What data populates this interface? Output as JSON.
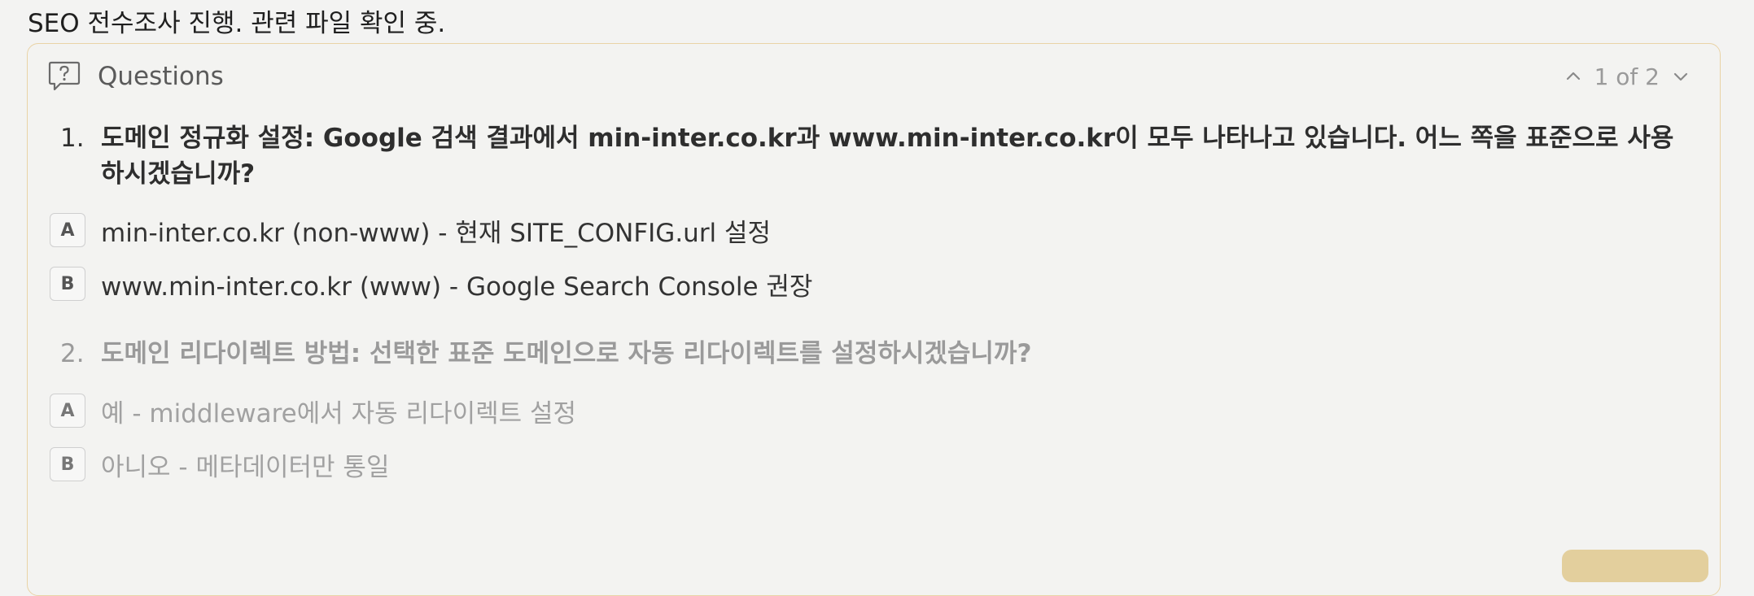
{
  "intro": "SEO 전수조사 진행. 관련 파일 확인 중.",
  "panel": {
    "title": "Questions",
    "pager": "1 of 2",
    "icons": {
      "header": "question-bubble-icon",
      "prev": "chevron-up-icon",
      "next": "chevron-down-icon"
    },
    "accent_border": "#e9d3a6",
    "submit_color": "#e3cf9d"
  },
  "questions": [
    {
      "number": "1.",
      "text": "도메인 정규화 설정: Google 검색 결과에서 min-inter.co.kr과 www.min-inter.co.kr이 모두 나타나고 있습니다. 어느 쪽을 표준으로 사용하시겠습니까?",
      "options": [
        {
          "key": "A",
          "label": "min-inter.co.kr (non-www) - 현재 SITE_CONFIG.url 설정"
        },
        {
          "key": "B",
          "label": "www.min-inter.co.kr (www) - Google Search Console 권장"
        }
      ]
    },
    {
      "number": "2.",
      "text": "도메인 리다이렉트 방법: 선택한 표준 도메인으로 자동 리다이렉트를 설정하시겠습니까?",
      "options": [
        {
          "key": "A",
          "label": "예 - middleware에서 자동 리다이렉트 설정"
        },
        {
          "key": "B",
          "label": "아니오 - 메타데이터만 통일"
        }
      ]
    }
  ]
}
